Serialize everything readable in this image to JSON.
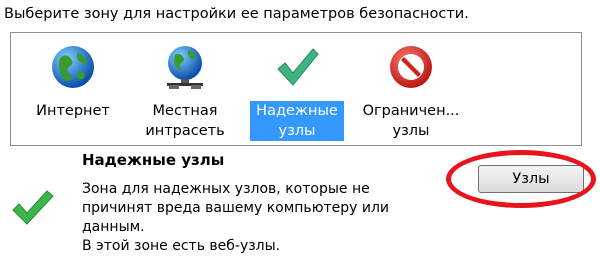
{
  "instruction": "Выберите зону для настройки ее параметров безопасности.",
  "zones": [
    {
      "label": "Интернет",
      "icon": "globe-icon",
      "selected": false
    },
    {
      "label": "Местная\nинтрасеть",
      "icon": "globe-network-icon",
      "selected": false
    },
    {
      "label": "Надежные\nузлы",
      "icon": "checkmark-icon",
      "selected": true
    },
    {
      "label": "Ограничен...\nузлы",
      "icon": "no-entry-icon",
      "selected": false
    }
  ],
  "details": {
    "title": "Надежные узлы",
    "description": "Зона для надежных узлов, которые не\nпричинят вреда вашему компьютеру или\nданным.\nВ этой зоне есть веб-узлы.",
    "icon": "checkmark-icon"
  },
  "sites_button_label": "Узлы",
  "colors": {
    "selection": "#3399ff",
    "annotation": "#e8131b",
    "checkmark": "#3fb37f"
  }
}
